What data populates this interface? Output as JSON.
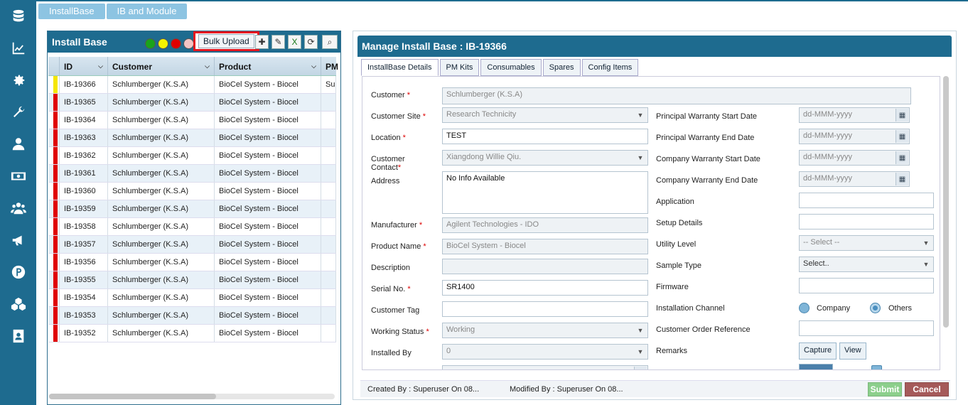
{
  "top_tabs": [
    "InstallBase",
    "IB and Module"
  ],
  "left": {
    "title": "Install Base",
    "bulk_upload": "Bulk Upload",
    "columns": [
      "ID",
      "Customer",
      "Product",
      "PM"
    ],
    "rows": [
      {
        "id": "IB-19366",
        "customer": "Schlumberger (K.S.A)",
        "product": "BioCel System - Biocel",
        "pm": "Su",
        "flag": "#f5e600"
      },
      {
        "id": "IB-19365",
        "customer": "Schlumberger (K.S.A)",
        "product": "BioCel System - Biocel",
        "pm": "",
        "flag": "#e00000"
      },
      {
        "id": "IB-19364",
        "customer": "Schlumberger (K.S.A)",
        "product": "BioCel System - Biocel",
        "pm": "",
        "flag": "#e00000"
      },
      {
        "id": "IB-19363",
        "customer": "Schlumberger (K.S.A)",
        "product": "BioCel System - Biocel",
        "pm": "",
        "flag": "#e00000"
      },
      {
        "id": "IB-19362",
        "customer": "Schlumberger (K.S.A)",
        "product": "BioCel System - Biocel",
        "pm": "",
        "flag": "#e00000"
      },
      {
        "id": "IB-19361",
        "customer": "Schlumberger (K.S.A)",
        "product": "BioCel System - Biocel",
        "pm": "",
        "flag": "#e00000"
      },
      {
        "id": "IB-19360",
        "customer": "Schlumberger (K.S.A)",
        "product": "BioCel System - Biocel",
        "pm": "",
        "flag": "#e00000"
      },
      {
        "id": "IB-19359",
        "customer": "Schlumberger (K.S.A)",
        "product": "BioCel System - Biocel",
        "pm": "",
        "flag": "#e00000"
      },
      {
        "id": "IB-19358",
        "customer": "Schlumberger (K.S.A)",
        "product": "BioCel System - Biocel",
        "pm": "",
        "flag": "#e00000"
      },
      {
        "id": "IB-19357",
        "customer": "Schlumberger (K.S.A)",
        "product": "BioCel System - Biocel",
        "pm": "",
        "flag": "#e00000"
      },
      {
        "id": "IB-19356",
        "customer": "Schlumberger (K.S.A)",
        "product": "BioCel System - Biocel",
        "pm": "",
        "flag": "#e00000"
      },
      {
        "id": "IB-19355",
        "customer": "Schlumberger (K.S.A)",
        "product": "BioCel System - Biocel",
        "pm": "",
        "flag": "#e00000"
      },
      {
        "id": "IB-19354",
        "customer": "Schlumberger (K.S.A)",
        "product": "BioCel System - Biocel",
        "pm": "",
        "flag": "#e00000"
      },
      {
        "id": "IB-19353",
        "customer": "Schlumberger (K.S.A)",
        "product": "BioCel System - Biocel",
        "pm": "",
        "flag": "#e00000"
      },
      {
        "id": "IB-19352",
        "customer": "Schlumberger (K.S.A)",
        "product": "BioCel System - Biocel",
        "pm": "",
        "flag": "#e00000"
      }
    ]
  },
  "right": {
    "title": "Manage Install Base : IB-19366",
    "tabs": [
      "InstallBase Details",
      "PM Kits",
      "Consumables",
      "Spares",
      "Config Items"
    ],
    "fields": {
      "customer": {
        "label": "Customer",
        "value": "Schlumberger (K.S.A)"
      },
      "customer_site": {
        "label": "Customer Site",
        "value": "Research Technicity"
      },
      "location": {
        "label": "Location",
        "value": "TEST"
      },
      "customer_contact": {
        "label": "Customer Contact",
        "value": "Xiangdong Willie Qiu."
      },
      "address": {
        "label": "Address",
        "value": "No Info Available"
      },
      "manufacturer": {
        "label": "Manufacturer",
        "value": "Agilent Technologies - IDO"
      },
      "product_name": {
        "label": "Product Name",
        "value": "BioCel System - Biocel"
      },
      "description": {
        "label": "Description",
        "value": ""
      },
      "serial_no": {
        "label": "Serial No.",
        "value": "SR1400"
      },
      "customer_tag": {
        "label": "Customer Tag",
        "value": ""
      },
      "working_status": {
        "label": "Working Status",
        "value": "Working"
      },
      "installed_by": {
        "label": "Installed By",
        "value": "0"
      },
      "principal_start": {
        "label": "Principal Warranty Start Date",
        "value": "dd-MMM-yyyy"
      },
      "principal_end": {
        "label": "Principal Warranty End Date",
        "value": "dd-MMM-yyyy"
      },
      "company_start": {
        "label": "Company Warranty Start Date",
        "value": "dd-MMM-yyyy"
      },
      "company_end": {
        "label": "Company Warranty End Date",
        "value": "dd-MMM-yyyy"
      },
      "application": {
        "label": "Application",
        "value": ""
      },
      "setup_details": {
        "label": "Setup Details",
        "value": ""
      },
      "utility_level": {
        "label": "Utility Level",
        "value": "-- Select --"
      },
      "sample_type": {
        "label": "Sample Type",
        "value": "Select.."
      },
      "firmware": {
        "label": "Firmware",
        "value": ""
      },
      "installation_channel": {
        "label": "Installation Channel",
        "options": [
          "Company",
          "Others"
        ]
      },
      "customer_order_ref": {
        "label": "Customer Order Reference",
        "value": ""
      },
      "remarks": {
        "label": "Remarks",
        "capture": "Capture",
        "view": "View"
      }
    },
    "created_by": "Created By : Superuser On 08...",
    "modified_by": "Modified By : Superuser On 08...",
    "submit": "Submit",
    "cancel": "Cancel"
  },
  "colors": {
    "sidebar": "#1e6b8f",
    "header": "#1e6b8f",
    "accent_light": "#8dc4e2",
    "highlight_box": "#e2161f"
  }
}
